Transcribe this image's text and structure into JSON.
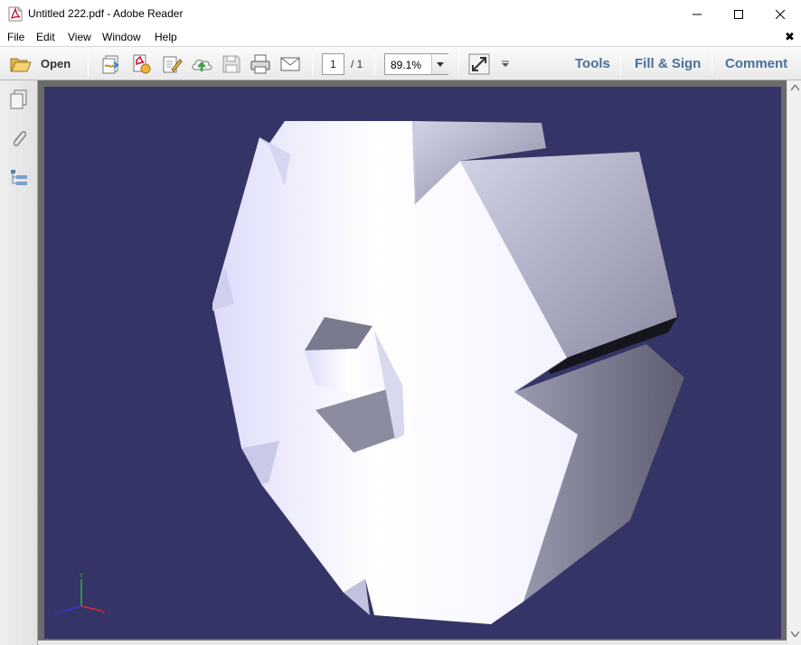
{
  "window": {
    "title": "Untitled 222.pdf - Adobe Reader"
  },
  "menu": {
    "items": [
      "File",
      "Edit",
      "View",
      "Window",
      "Help"
    ]
  },
  "toolbar": {
    "open_label": "Open",
    "page_current": "1",
    "page_total": "/ 1",
    "zoom": "89.1%",
    "tools_label": "Tools",
    "fill_sign_label": "Fill & Sign",
    "comment_label": "Comment",
    "icons": [
      "folder-open-icon",
      "create-pdf-icon",
      "export-pdf-icon",
      "edit-pdf-icon",
      "upload-cloud-icon",
      "save-icon",
      "print-icon",
      "email-icon",
      "fullscreen-icon"
    ]
  },
  "left_panel": {
    "icons": [
      "page-thumbnails-icon",
      "attachments-icon",
      "model-tree-icon"
    ]
  },
  "viewer": {
    "background_color": "#353466",
    "model_color": "#e6e6f8",
    "axis_colors": {
      "x": "#d23232",
      "y": "#33b533",
      "z": "#3535d2"
    }
  },
  "colors": {
    "link_blue": "#4b6f97",
    "chrome_gray": "#e9e9e9"
  }
}
